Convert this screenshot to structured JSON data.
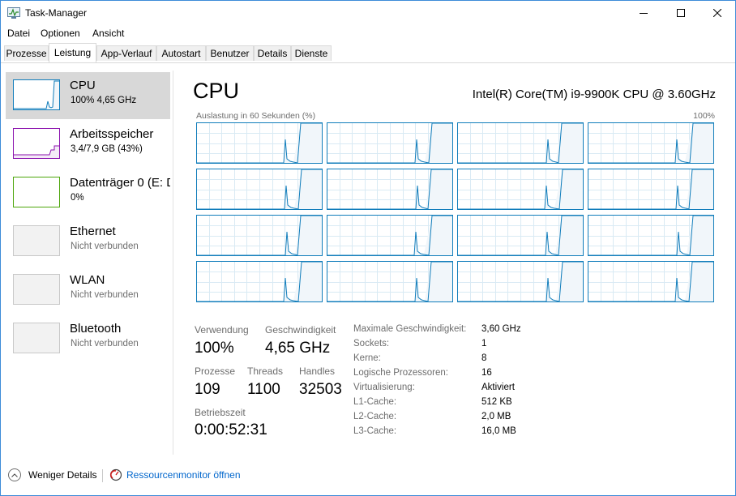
{
  "window": {
    "title": "Task-Manager",
    "accent_border": "#3c8bd8"
  },
  "window_controls": {
    "minimize_icon": "minimize-icon",
    "maximize_icon": "maximize-icon",
    "close_icon": "close-icon"
  },
  "menu": {
    "items": [
      "Datei",
      "Optionen",
      "Ansicht"
    ]
  },
  "tabs": [
    {
      "label": "Prozesse",
      "active": false
    },
    {
      "label": "Leistung",
      "active": true
    },
    {
      "label": "App-Verlauf",
      "active": false
    },
    {
      "label": "Autostart",
      "active": false
    },
    {
      "label": "Benutzer",
      "active": false
    },
    {
      "label": "Details",
      "active": false
    },
    {
      "label": "Dienste",
      "active": false
    }
  ],
  "sidebar": {
    "items": [
      {
        "name": "CPU",
        "sub": "100%  4,65 GHz",
        "color": "#117dbb",
        "selected": true
      },
      {
        "name": "Arbeitsspeicher",
        "sub": "3,4/7,9 GB (43%)",
        "color": "#8b12ae",
        "selected": false
      },
      {
        "name": "Datenträger 0 (E: D",
        "sub": "0%",
        "color": "#4da60c",
        "selected": false
      },
      {
        "name": "Ethernet",
        "sub": "Nicht verbunden",
        "color": "#c8c8c8",
        "selected": false
      },
      {
        "name": "WLAN",
        "sub": "Nicht verbunden",
        "color": "#c8c8c8",
        "selected": false
      },
      {
        "name": "Bluetooth",
        "sub": "Nicht verbunden",
        "color": "#c8c8c8",
        "selected": false
      }
    ]
  },
  "main": {
    "title": "CPU",
    "model": "Intel(R) Core(TM) i9-9900K CPU @ 3.60GHz",
    "graph_label": "Auslastung in 60 Sekunden (%)",
    "graph_max": "100%",
    "graph_color": "#117dbb",
    "graph_fill": "#f1f6fa"
  },
  "stats": {
    "usage_label": "Verwendung",
    "usage_value": "100%",
    "speed_label": "Geschwindigkeit",
    "speed_value": "4,65 GHz",
    "processes_label": "Prozesse",
    "processes_value": "109",
    "threads_label": "Threads",
    "threads_value": "1100",
    "handles_label": "Handles",
    "handles_value": "32503",
    "uptime_label": "Betriebszeit",
    "uptime_value": "0:00:52:31"
  },
  "info": [
    {
      "key": "Maximale Geschwindigkeit:",
      "value": "3,60 GHz"
    },
    {
      "key": "Sockets:",
      "value": "1"
    },
    {
      "key": "Kerne:",
      "value": "8"
    },
    {
      "key": "Logische Prozessoren:",
      "value": "16"
    },
    {
      "key": "Virtualisierung:",
      "value": "Aktiviert"
    },
    {
      "key": "L1-Cache:",
      "value": "512 KB"
    },
    {
      "key": "L2-Cache:",
      "value": "2,0 MB"
    },
    {
      "key": "L3-Cache:",
      "value": "16,0 MB"
    }
  ],
  "footer": {
    "less_details": "Weniger Details",
    "less_details_icon": "chevron-up-icon",
    "resmon": "Ressourcenmonitor öffnen",
    "resmon_icon": "resource-monitor-icon"
  }
}
